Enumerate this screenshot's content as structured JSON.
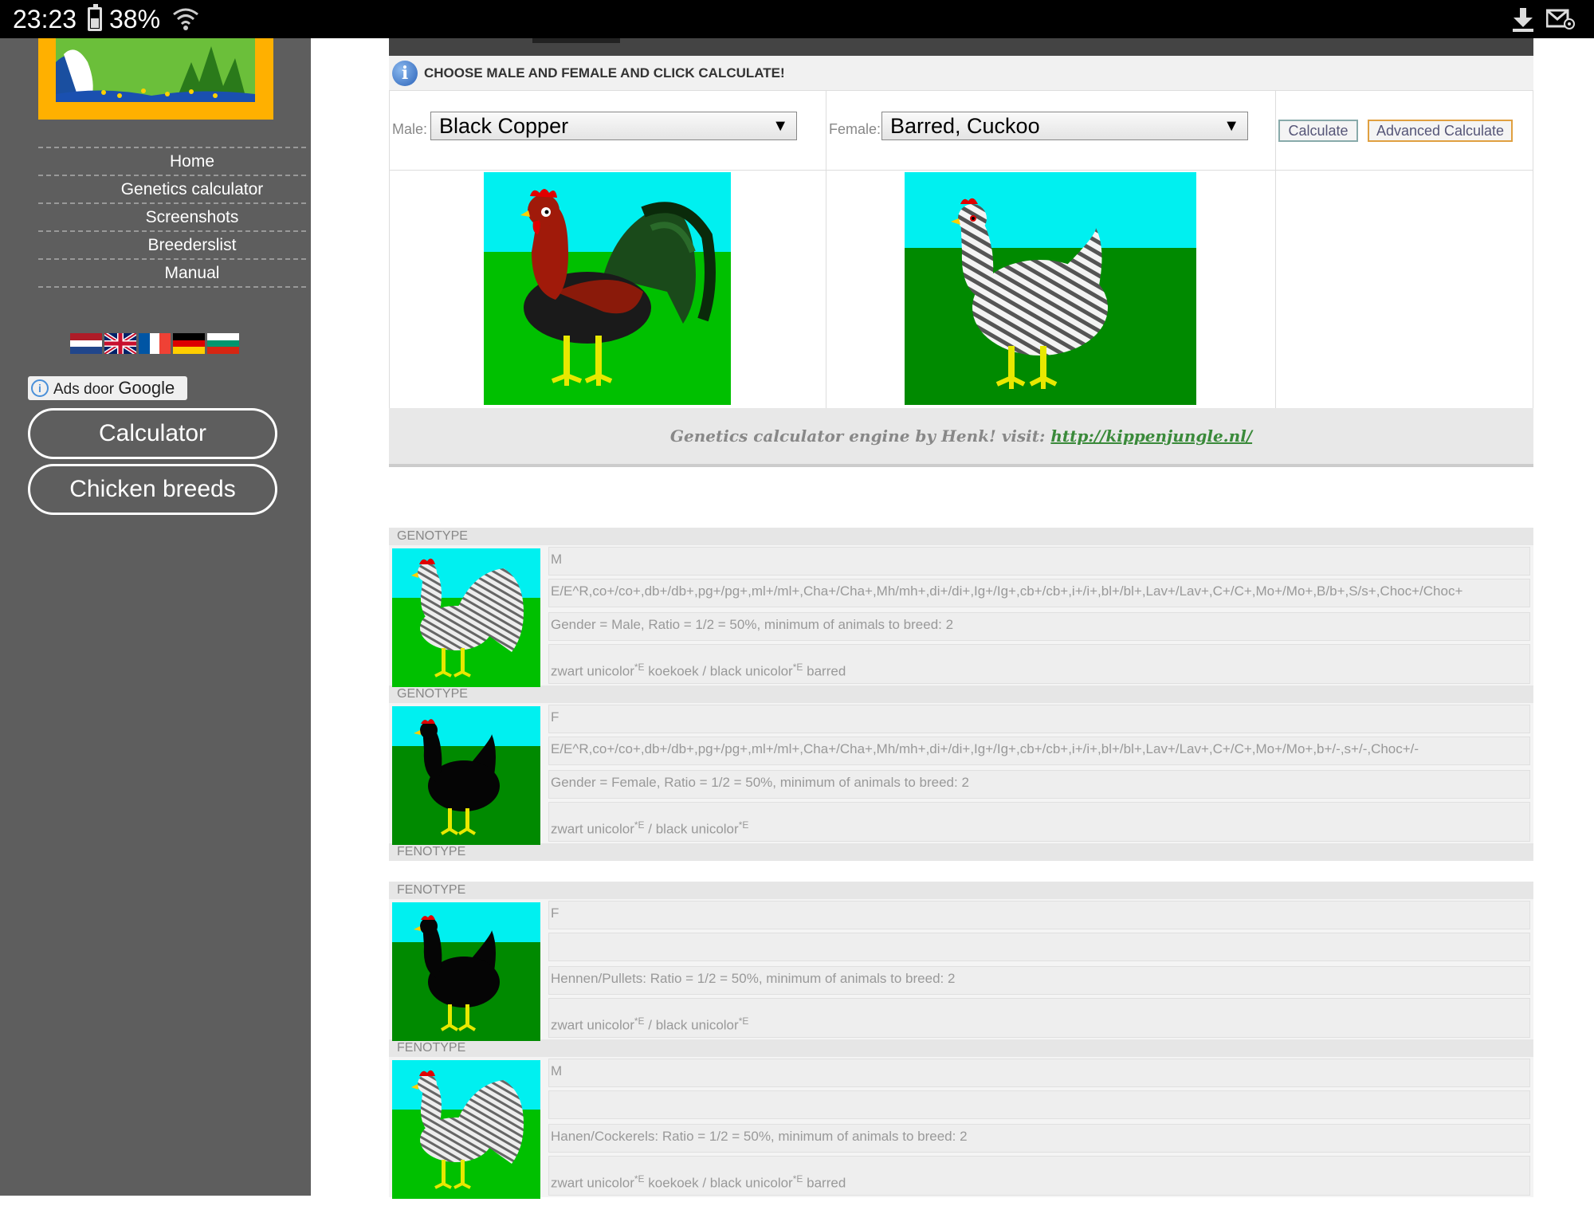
{
  "statusbar": {
    "time": "23:23",
    "battery": "38%"
  },
  "nav": [
    "Home",
    "Genetics calculator",
    "Screenshots",
    "Breederslist",
    "Manual"
  ],
  "ads": {
    "prefix": "Ads door",
    "brand": "Google"
  },
  "side_buttons": {
    "calculator": "Calculator",
    "breeds": "Chicken breeds"
  },
  "calc": {
    "instruction": "CHOOSE MALE AND FEMALE AND CLICK CALCULATE!",
    "male_label": "Male:",
    "male_value": "Black Copper",
    "female_label": "Female:",
    "female_value": "Barred, Cuckoo",
    "calculate": "Calculate",
    "advanced": "Advanced Calculate",
    "credit_text": "Genetics calculator engine by Henk! visit:",
    "credit_link": "http://kippenjungle.nl/"
  },
  "results": [
    {
      "head": "GENOTYPE",
      "sex": "M",
      "thumb": "barred-rooster",
      "genes": "E/E^R,co+/co+,db+/db+,pg+/pg+,ml+/ml+,Cha+/Cha+,Mh/mh+,di+/di+,Ig+/Ig+,cb+/cb+,i+/i+,bl+/bl+,Lav+/Lav+,C+/C+,Mo+/Mo+,B/b+,S/s+,Choc+/Choc+",
      "ratio": "Gender = Male, Ratio = 1/2 = 50%, minimum of animals to breed: 2",
      "desc_a": "zwart unicolor",
      "desc_b": " koekoek / black unicolor",
      "desc_c": " barred",
      "sup": "*E"
    },
    {
      "head": "GENOTYPE",
      "sex": "F",
      "thumb": "black-hen",
      "genes": "E/E^R,co+/co+,db+/db+,pg+/pg+,ml+/ml+,Cha+/Cha+,Mh/mh+,di+/di+,Ig+/Ig+,cb+/cb+,i+/i+,bl+/bl+,Lav+/Lav+,C+/C+,Mo+/Mo+,b+/-,s+/-,Choc+/-",
      "ratio": "Gender = Female, Ratio = 1/2 = 50%, minimum of animals to breed: 2",
      "desc_a": "zwart unicolor",
      "desc_b": " / black unicolor",
      "desc_c": "",
      "sup": "*E"
    },
    {
      "head": "FENOTYPE",
      "sex": "F",
      "thumb": "black-hen",
      "genes": "",
      "ratio": "Hennen/Pullets: Ratio = 1/2 = 50%, minimum of animals to breed: 2",
      "desc_a": "zwart unicolor",
      "desc_b": " / black unicolor",
      "desc_c": "",
      "sup": "*E"
    },
    {
      "head": "FENOTYPE",
      "sex": "M",
      "thumb": "barred-rooster",
      "genes": "",
      "ratio": "Hanen/Cockerels: Ratio = 1/2 = 50%, minimum of animals to breed: 2",
      "desc_a": "zwart unicolor",
      "desc_b": " koekoek / black unicolor",
      "desc_c": " barred",
      "sup": "*E"
    }
  ],
  "spacer_head": "FENOTYPE",
  "colors": {
    "sidebar": "#5e5e5e",
    "logo_frame": "#ffb000",
    "sky": "#00f0f0",
    "grass": "#00c000",
    "link": "#3a8a3a"
  }
}
